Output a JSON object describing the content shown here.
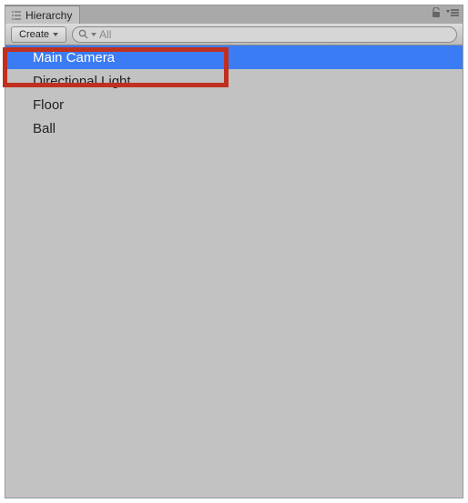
{
  "tab": {
    "title": "Hierarchy"
  },
  "toolbar": {
    "create_label": "Create",
    "search_placeholder": "All",
    "search_value": ""
  },
  "items": [
    {
      "name": "Main Camera",
      "selected": true
    },
    {
      "name": "Directional Light",
      "selected": false
    },
    {
      "name": "Floor",
      "selected": false
    },
    {
      "name": "Ball",
      "selected": false
    }
  ]
}
